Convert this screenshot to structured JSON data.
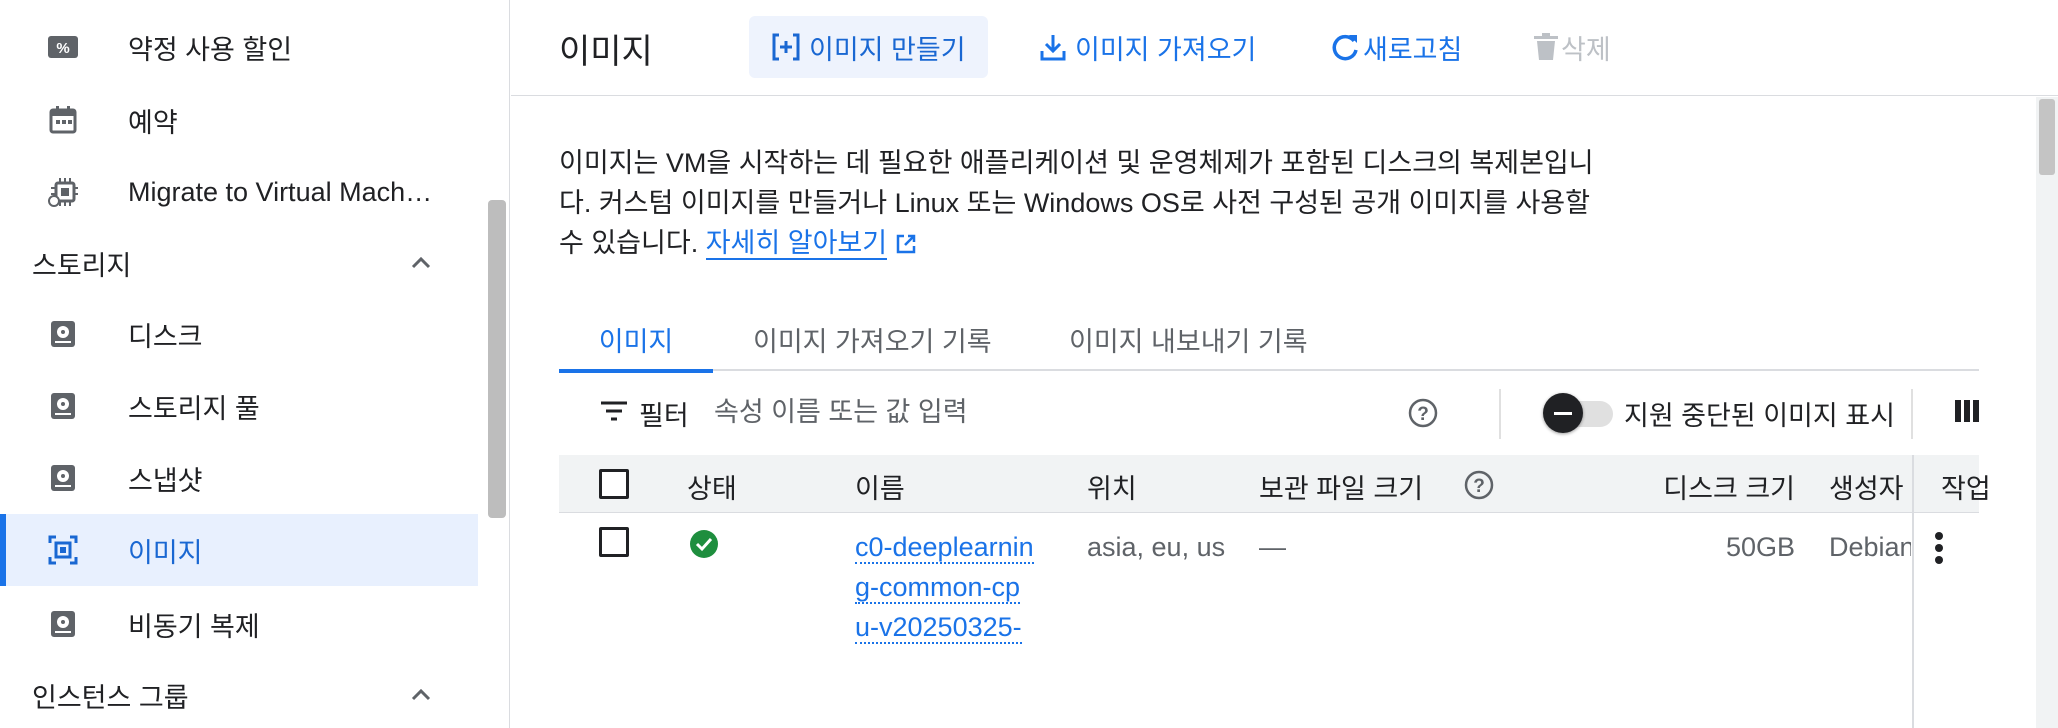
{
  "sidebar": {
    "items_top": [
      {
        "label": "약정 사용 할인",
        "icon": "percent-tag-icon"
      },
      {
        "label": "예약",
        "icon": "calendar-icon"
      },
      {
        "label": "Migrate to Virtual Mach…",
        "icon": "migrate-chip-icon"
      }
    ],
    "storage_section": {
      "label": "스토리지",
      "icon": "chevron-up-icon"
    },
    "storage_items": [
      {
        "label": "디스크",
        "icon": "disk-icon"
      },
      {
        "label": "스토리지 풀",
        "icon": "disk-icon"
      },
      {
        "label": "스냅샷",
        "icon": "disk-icon"
      },
      {
        "label": "이미지",
        "icon": "image-icon",
        "active": true
      },
      {
        "label": "비동기 복제",
        "icon": "disk-icon"
      }
    ],
    "instance_group_section": {
      "label": "인스턴스 그룹",
      "icon": "chevron-up-icon"
    }
  },
  "header": {
    "title": "이미지",
    "create_label": "이미지 만들기",
    "import_label": "이미지 가져오기",
    "refresh_label": "새로고침",
    "delete_label": "삭제"
  },
  "main": {
    "description": "이미지는 VM을 시작하는 데 필요한 애플리케이션 및 운영체제가 포함된 디스크의 복제본입니다. 커스텀 이미지를 만들거나 Linux 또는 Windows OS로 사전 구성된 공개 이미지를 사용할 수 있습니다.",
    "learn_more": "자세히 알아보기",
    "tabs": [
      "이미지",
      "이미지 가져오기 기록",
      "이미지 내보내기 기록"
    ],
    "filter": {
      "label": "필터",
      "placeholder": "속성 이름 또는 값 입력"
    },
    "deprecated_toggle_label": "지원 중단된 이미지 표시",
    "table": {
      "headers": {
        "status": "상태",
        "name": "이름",
        "location": "위치",
        "archive_size": "보관 파일 크기",
        "disk_size": "디스크 크기",
        "creator": "생성자",
        "actions": "작업"
      },
      "rows": [
        {
          "name": "c0-deeplearning-common-cpu-v20250325-",
          "location": "asia, eu, us",
          "archive_size": "—",
          "disk_size": "50GB",
          "creator": "Debian"
        }
      ]
    }
  },
  "colors": {
    "accent": "#1a73e8",
    "active_bg": "#e8f0fe",
    "status_ok": "#1e8e3e"
  }
}
